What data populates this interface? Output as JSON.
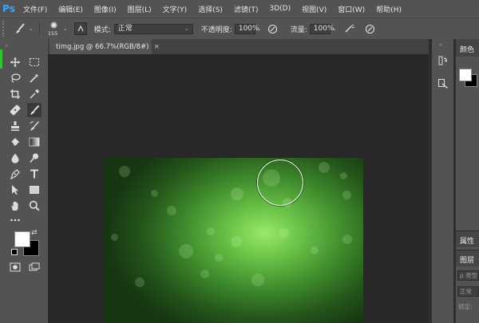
{
  "app": {
    "logo": "Ps"
  },
  "menu": [
    "文件(F)",
    "编辑(E)",
    "图像(I)",
    "图层(L)",
    "文字(Y)",
    "选择(S)",
    "滤镜(T)",
    "3D(D)",
    "视图(V)",
    "窗口(W)",
    "帮助(H)"
  ],
  "options": {
    "brush_size": "155",
    "mode_label": "模式:",
    "mode_value": "正常",
    "opacity_label": "不透明度:",
    "opacity_value": "100%",
    "flow_label": "流量:",
    "flow_value": "100%"
  },
  "document": {
    "tab_title": "timg.jpg @ 66.7%(RGB/8#)",
    "close_glyph": "×"
  },
  "panels": {
    "color_title": "颜色",
    "properties_title": "属性",
    "layers_title": "图层",
    "layers_search": "ρ 类型",
    "layers_mode": "正常",
    "layers_lock": "锁定:"
  },
  "colors": {
    "ui_dark": "#282828",
    "panel": "#535353",
    "foreground": "#ffffff",
    "background": "#000000",
    "accent": "#31a8ff"
  },
  "icons": [
    "move-icon",
    "marquee-icon",
    "lasso-icon",
    "magic-wand-icon",
    "crop-icon",
    "eyedropper-icon",
    "healing-icon",
    "brush-icon",
    "stamp-icon",
    "history-brush-icon",
    "eraser-icon",
    "gradient-icon",
    "blur-icon",
    "dodge-icon",
    "pen-icon",
    "type-icon",
    "path-select-icon",
    "rectangle-icon",
    "hand-icon",
    "zoom-icon",
    "more-icon"
  ]
}
